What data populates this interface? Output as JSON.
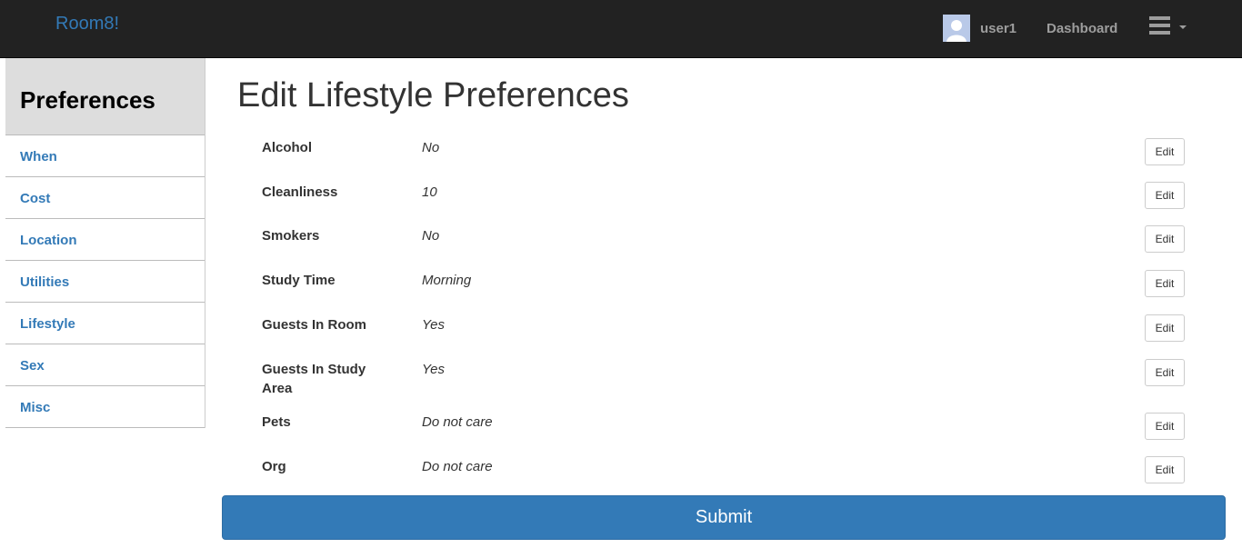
{
  "navbar": {
    "brand": "Room8!",
    "username": "user1",
    "dashboard_label": "Dashboard"
  },
  "sidebar": {
    "title": "Preferences",
    "items": [
      {
        "label": "When"
      },
      {
        "label": "Cost"
      },
      {
        "label": "Location"
      },
      {
        "label": "Utilities"
      },
      {
        "label": "Lifestyle"
      },
      {
        "label": "Sex"
      },
      {
        "label": "Misc"
      }
    ]
  },
  "main": {
    "title": "Edit Lifestyle Preferences",
    "edit_label": "Edit",
    "preferences": [
      {
        "label": "Alcohol",
        "value": "No"
      },
      {
        "label": "Cleanliness",
        "value": "10"
      },
      {
        "label": "Smokers",
        "value": "No"
      },
      {
        "label": "Study Time",
        "value": "Morning"
      },
      {
        "label": "Guests In Room",
        "value": "Yes"
      },
      {
        "label": "Guests In Study Area",
        "value": "Yes"
      },
      {
        "label": "Pets",
        "value": "Do not care"
      },
      {
        "label": "Org",
        "value": "Do not care"
      }
    ],
    "submit_label": "Submit"
  },
  "colors": {
    "navbar_bg": "#222222",
    "brand": "#337ab7",
    "link": "#337ab7",
    "primary_button": "#337ab7",
    "sidebar_header_bg": "#dddddd"
  },
  "icons": {
    "avatar": "user-avatar-icon",
    "menu": "hamburger-menu-icon",
    "caret": "caret-down-icon"
  }
}
